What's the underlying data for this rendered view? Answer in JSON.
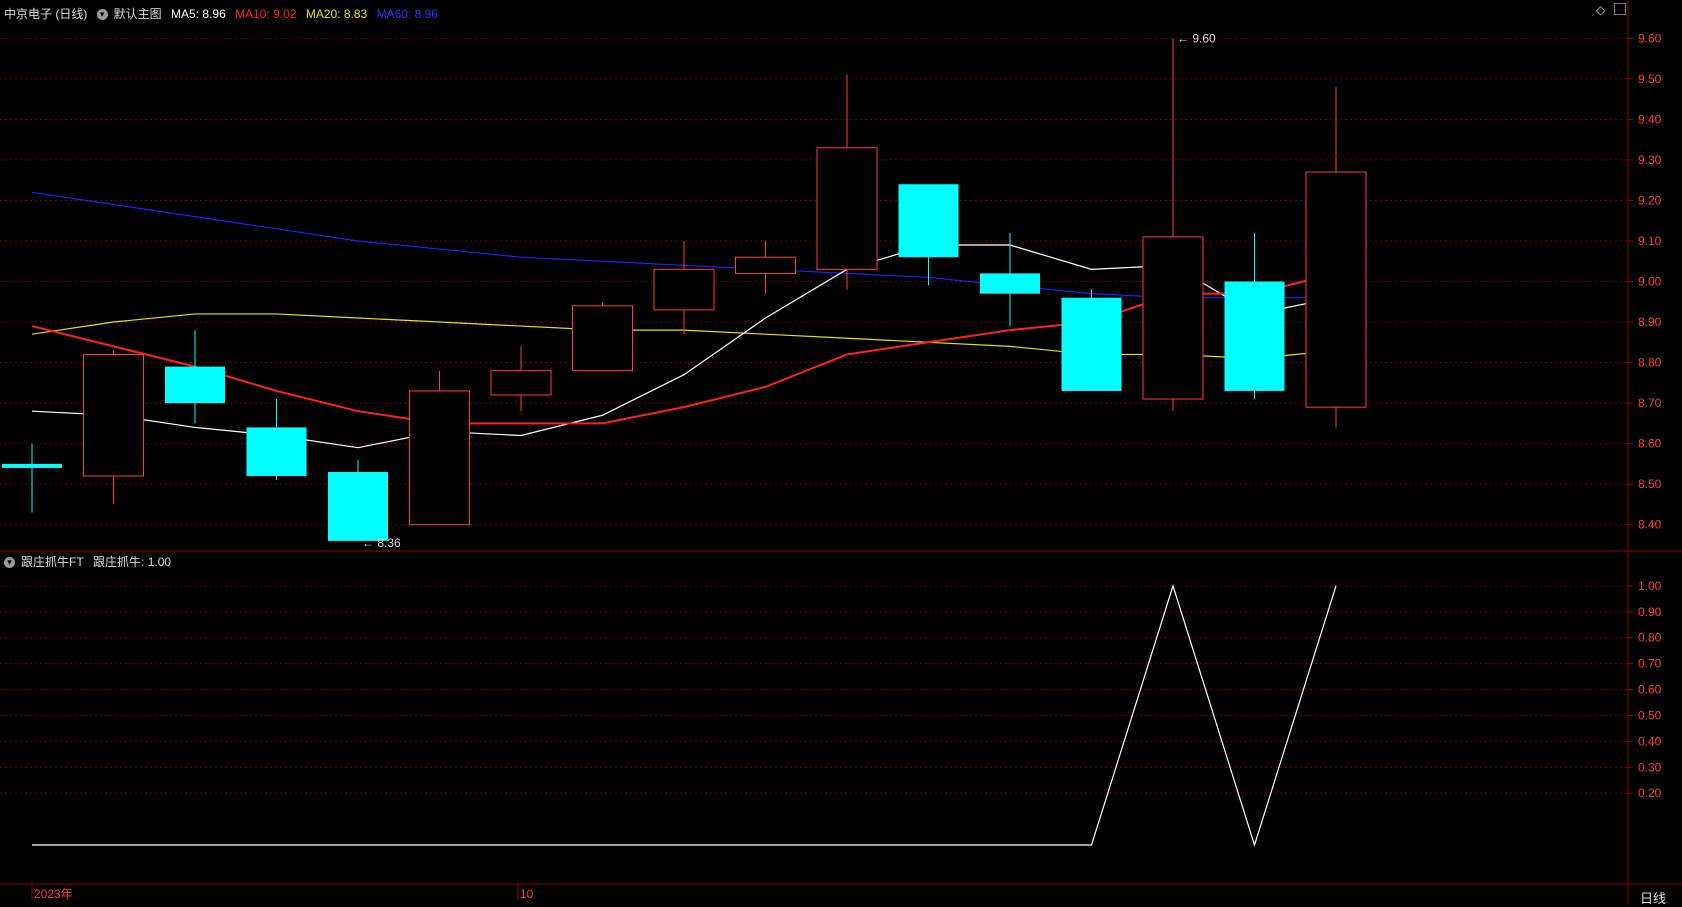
{
  "header": {
    "stock": "中京电子 (日线)",
    "template": "默认主图",
    "ma5_label": "MA5:",
    "ma5_value": "8.96",
    "ma10_label": "MA10:",
    "ma10_value": "9.02",
    "ma20_label": "MA20:",
    "ma20_value": "8.83",
    "ma60_label": "MA60:",
    "ma60_value": "8.96"
  },
  "indicator_header": {
    "name": "跟庄抓牛FT",
    "label": "跟庄抓牛:",
    "value": "1.00"
  },
  "x_axis": {
    "labels": [
      "2023年",
      "10"
    ],
    "period": "日线"
  },
  "colors": {
    "up": "#ff3c3c",
    "down": "#00ffff",
    "ma5": "#ffffff",
    "ma10": "#ff2020",
    "ma20": "#e6e600",
    "ma60": "#2020ff",
    "grid": "#7a0000",
    "axis_text": "#ff3c3c"
  },
  "chart_data": [
    {
      "type": "candlestick",
      "title": "中京电子 (日线)",
      "ylim": [
        8.34,
        9.66
      ],
      "yticks": [
        8.4,
        8.5,
        8.6,
        8.7,
        8.8,
        8.9,
        9.0,
        9.1,
        9.2,
        9.3,
        9.4,
        9.5,
        9.6
      ],
      "candles": [
        {
          "open": 8.55,
          "high": 8.6,
          "low": 8.43,
          "close": 8.54
        },
        {
          "open": 8.52,
          "high": 8.83,
          "low": 8.45,
          "close": 8.82
        },
        {
          "open": 8.79,
          "high": 8.88,
          "low": 8.65,
          "close": 8.7
        },
        {
          "open": 8.64,
          "high": 8.71,
          "low": 8.51,
          "close": 8.52
        },
        {
          "open": 8.53,
          "high": 8.56,
          "low": 8.36,
          "close": 8.36
        },
        {
          "open": 8.4,
          "high": 8.78,
          "low": 8.4,
          "close": 8.73
        },
        {
          "open": 8.72,
          "high": 8.84,
          "low": 8.68,
          "close": 8.78
        },
        {
          "open": 8.78,
          "high": 8.95,
          "low": 8.78,
          "close": 8.94
        },
        {
          "open": 8.93,
          "high": 9.1,
          "low": 8.87,
          "close": 9.03
        },
        {
          "open": 9.02,
          "high": 9.1,
          "low": 8.97,
          "close": 9.06
        },
        {
          "open": 9.03,
          "high": 9.51,
          "low": 8.98,
          "close": 9.33
        },
        {
          "open": 9.24,
          "high": 9.24,
          "low": 8.99,
          "close": 9.06
        },
        {
          "open": 9.02,
          "high": 9.12,
          "low": 8.89,
          "close": 8.97
        },
        {
          "open": 8.96,
          "high": 8.98,
          "low": 8.73,
          "close": 8.73
        },
        {
          "open": 8.71,
          "high": 9.6,
          "low": 8.68,
          "close": 9.11
        },
        {
          "open": 9.0,
          "high": 9.12,
          "low": 8.71,
          "close": 8.73
        },
        {
          "open": 8.69,
          "high": 9.48,
          "low": 8.64,
          "close": 9.27
        }
      ],
      "ma5": [
        8.68,
        8.67,
        8.64,
        8.62,
        8.59,
        8.63,
        8.62,
        8.67,
        8.77,
        8.91,
        9.03,
        9.09,
        9.09,
        9.03,
        9.04,
        8.92,
        8.96
      ],
      "ma10": [
        8.89,
        8.84,
        8.79,
        8.73,
        8.68,
        8.65,
        8.65,
        8.65,
        8.69,
        8.74,
        8.82,
        8.85,
        8.88,
        8.9,
        8.97,
        8.97,
        9.02
      ],
      "ma20": [
        8.87,
        8.9,
        8.92,
        8.92,
        8.91,
        8.9,
        8.89,
        8.88,
        8.88,
        8.87,
        8.86,
        8.85,
        8.84,
        8.82,
        8.82,
        8.81,
        8.83
      ],
      "ma60": [
        9.22,
        9.19,
        9.16,
        9.13,
        9.1,
        9.08,
        9.06,
        9.05,
        9.04,
        9.03,
        9.02,
        9.01,
        8.99,
        8.97,
        8.96,
        8.96,
        8.96
      ],
      "annotations": [
        {
          "label": "9.60",
          "candle": 14,
          "value": 9.6
        },
        {
          "label": "8.36",
          "candle": 4,
          "value": 8.36
        }
      ]
    },
    {
      "type": "line",
      "title": "跟庄抓牛FT",
      "ylim": [
        0,
        1.1
      ],
      "yticks": [
        0.2,
        0.3,
        0.4,
        0.5,
        0.6,
        0.7,
        0.8,
        0.9,
        1.0
      ],
      "series": [
        {
          "name": "跟庄抓牛",
          "values": [
            0,
            0,
            0,
            0,
            0,
            0,
            0,
            0,
            0,
            0,
            0,
            0,
            0,
            0,
            1,
            0,
            1
          ]
        }
      ]
    }
  ]
}
